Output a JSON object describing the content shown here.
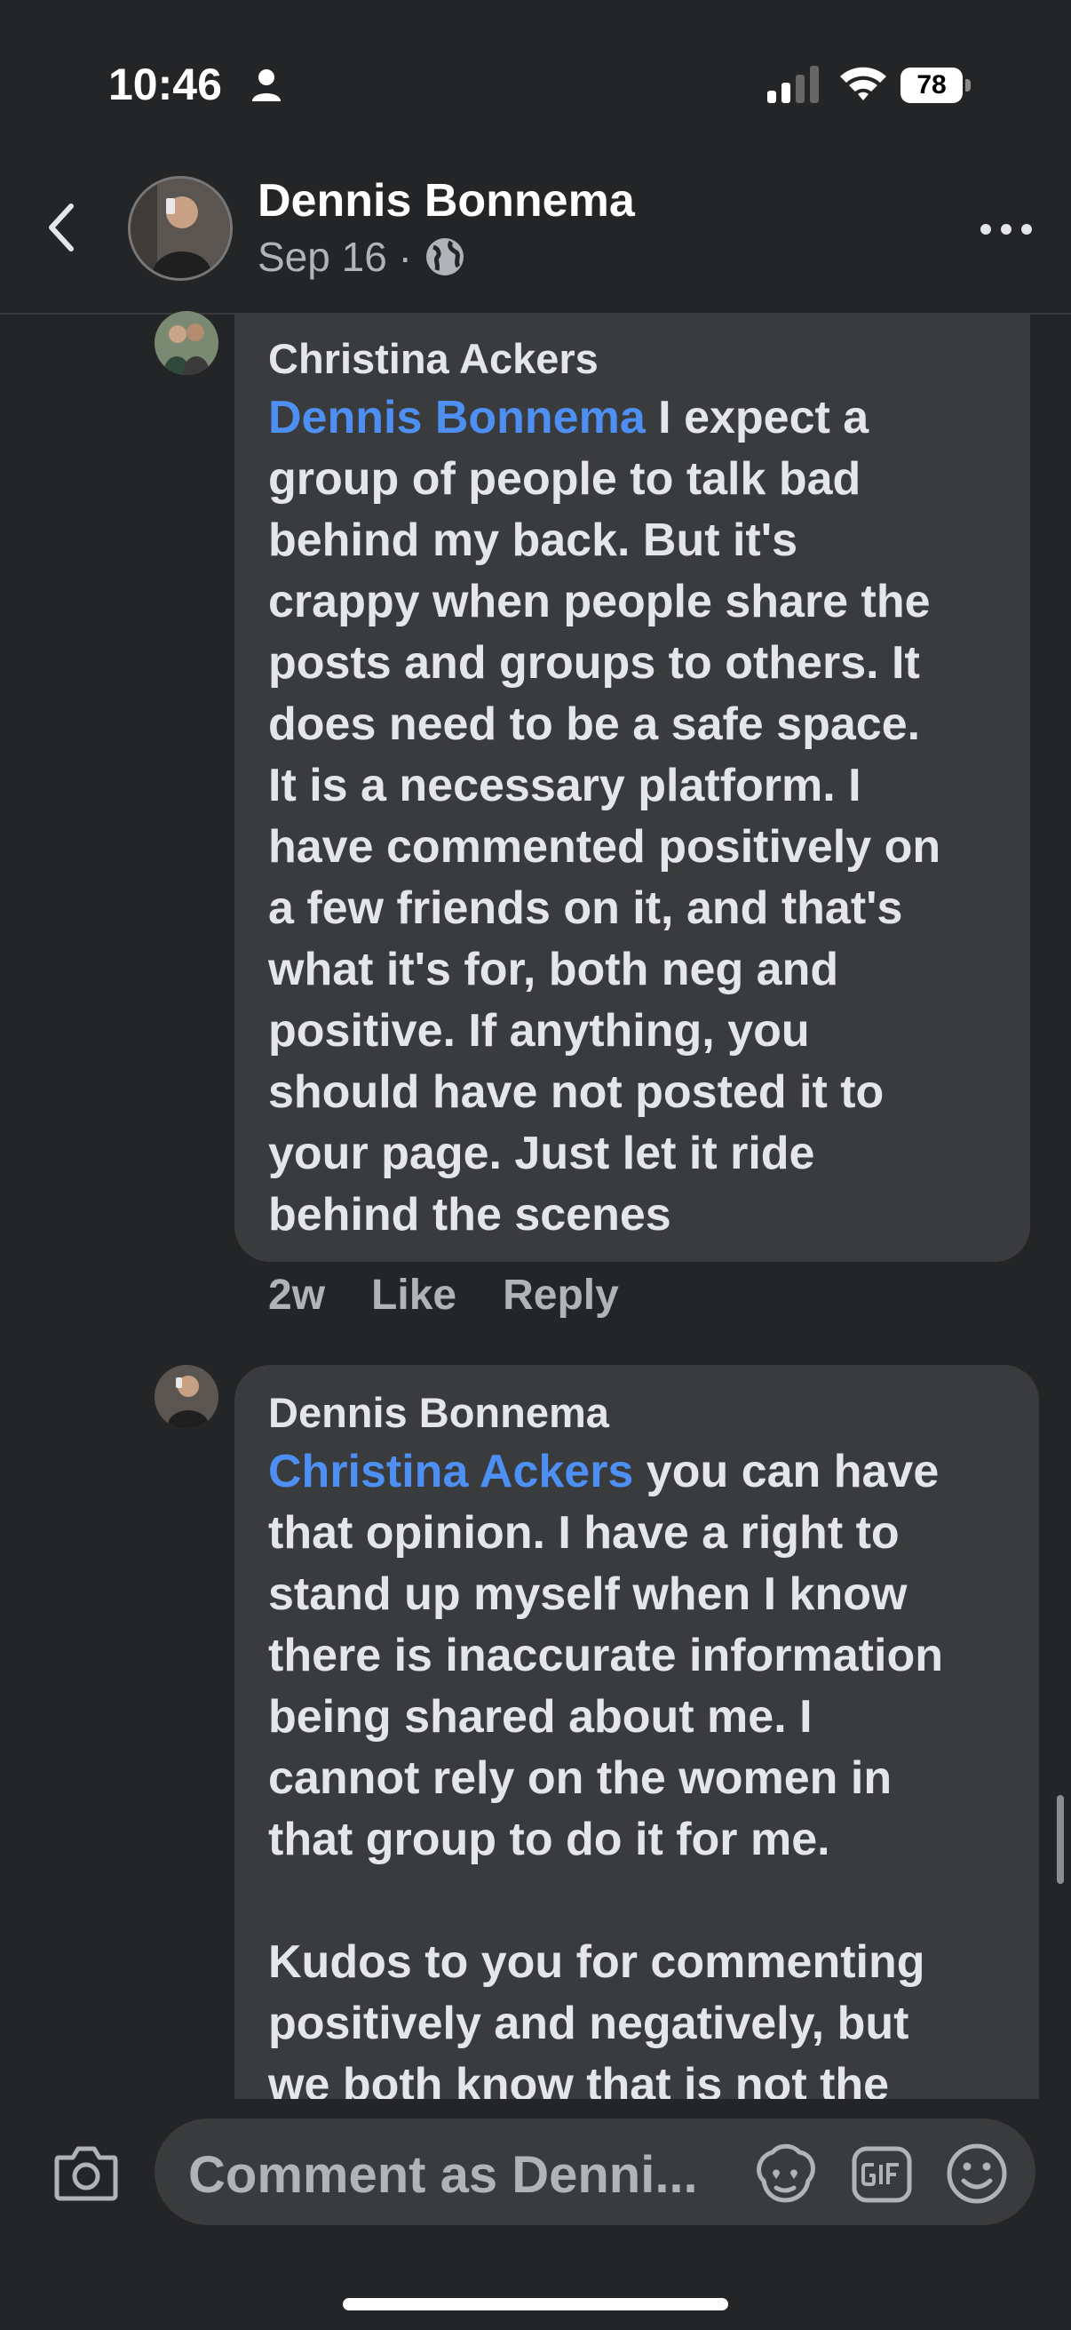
{
  "status_bar": {
    "time": "10:46",
    "battery": "78"
  },
  "header": {
    "name": "Dennis Bonnema",
    "date": "Sep 16 ·"
  },
  "comments": [
    {
      "author": "Christina Ackers",
      "mention": "Dennis Bonnema",
      "text": " I expect a\ngroup of people to talk bad\nbehind my back. But it's\ncrappy when people share the\nposts and groups to others. It\ndoes need to be a safe space.\nIt is a necessary platform. I\nhave commented positively on\na few friends on it, and that's\nwhat it's for, both neg and\npositive. If anything, you\nshould have not posted it to\nyour page. Just let it ride\nbehind the scenes",
      "time": "2w",
      "like": "Like",
      "reply": "Reply"
    },
    {
      "author": "Dennis Bonnema",
      "mention": "Christina Ackers",
      "text": " you can have\nthat opinion. I have a right to\nstand up myself when I know\nthere is inaccurate information\nbeing shared about me. I\ncannot rely on the women in\nthat group to do it for me.\n\nKudos to you for commenting\npositively and negatively, but\nwe both know that is not the"
    }
  ],
  "composer": {
    "placeholder": "Comment as Denni..."
  },
  "icons": {
    "back": "chevron-left-icon",
    "more": "more-icon",
    "globe": "globe-icon",
    "camera": "camera-icon",
    "avatar_sticker": "avatar-sticker-icon",
    "gif": "gif-icon",
    "emoji": "emoji-icon"
  },
  "colors": {
    "background": "#242526",
    "bubble": "#3a3b3c",
    "mention": "#4d8ff2",
    "muted": "#b0b3b8"
  }
}
